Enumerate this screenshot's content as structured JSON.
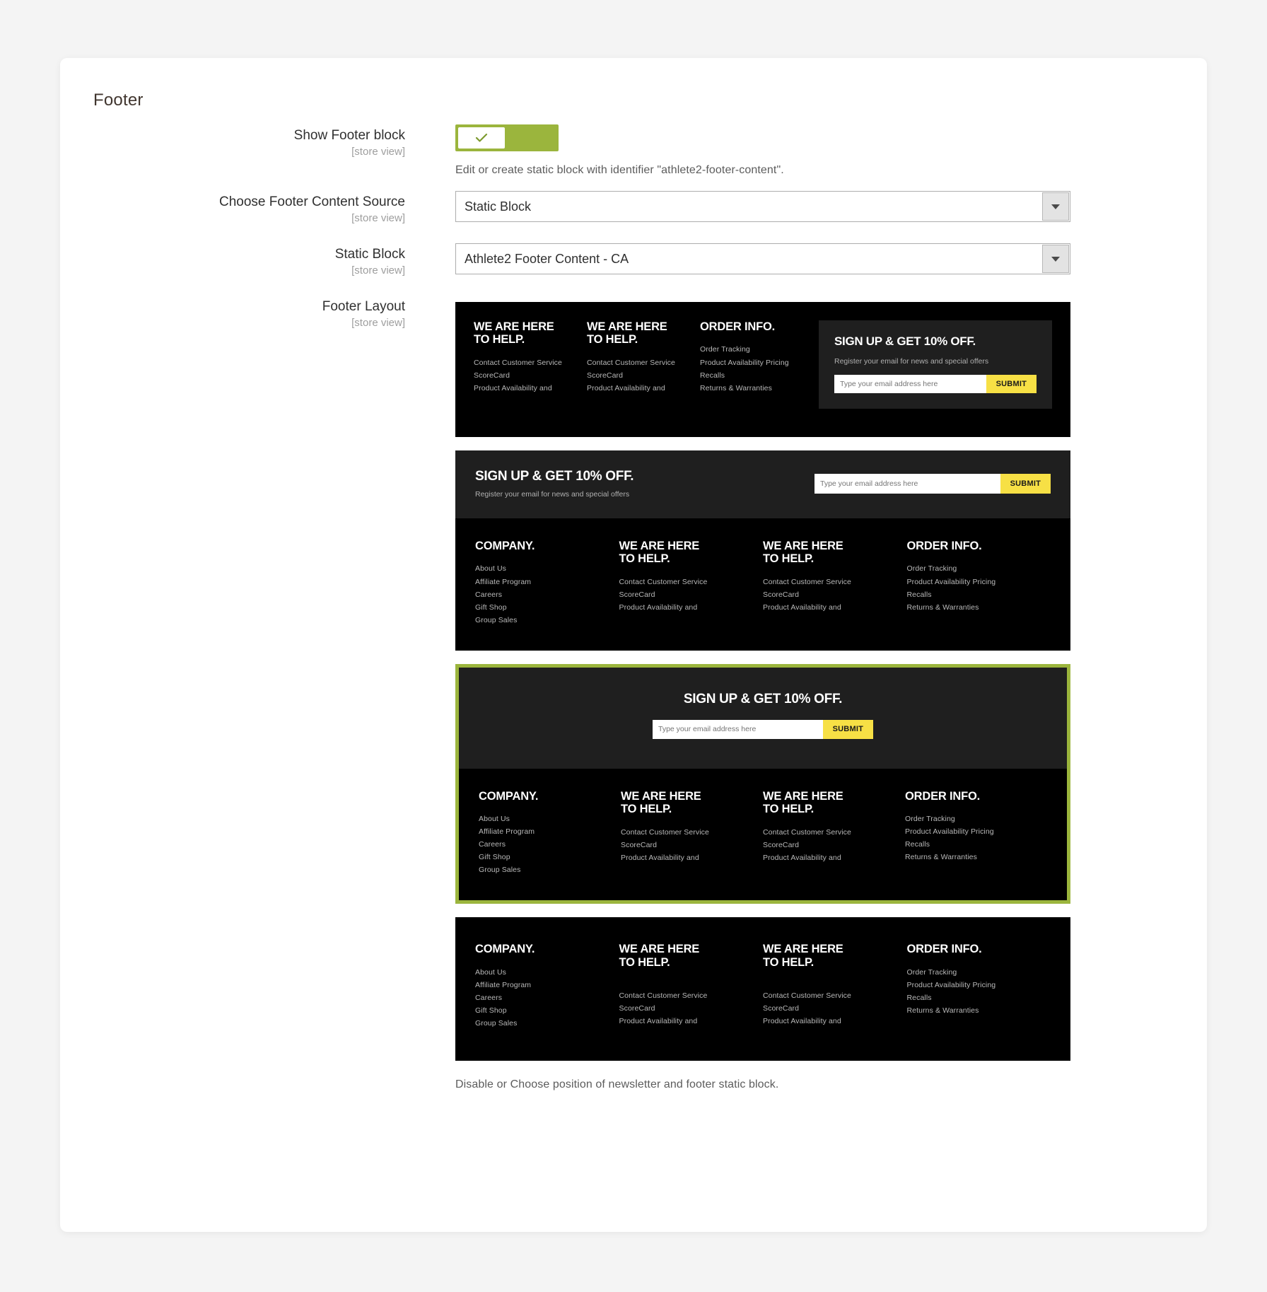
{
  "section": {
    "title": "Footer"
  },
  "fields": {
    "show_footer": {
      "label": "Show Footer block",
      "scope": "[store view]",
      "toggle_state": "on",
      "hint": "Edit or create static block with identifier \"athlete2-footer-content\"."
    },
    "content_source": {
      "label": "Choose Footer Content Source",
      "scope": "[store view]",
      "value": "Static Block"
    },
    "static_block": {
      "label": "Static Block",
      "scope": "[store view]",
      "value": "Athlete2 Footer Content - CA"
    },
    "footer_layout": {
      "label": "Footer Layout",
      "scope": "[store view]",
      "note": "Disable or Choose position of newsletter and footer static block."
    }
  },
  "newsletter": {
    "title": "SIGN UP & GET 10% OFF.",
    "subtitle": "Register your email for news and special offers",
    "placeholder": "Type your email address here",
    "submit_label": "SUBMIT"
  },
  "columns": {
    "company": {
      "heading": "COMPANY.",
      "links": [
        "About Us",
        "Affiliate Program",
        "Careers",
        "Gift Shop",
        "Group Sales"
      ]
    },
    "help": {
      "heading": "WE ARE HERE\nTO HELP.",
      "links": [
        "Contact Customer Service",
        "ScoreCard",
        "Product Availability and"
      ]
    },
    "order": {
      "heading": "ORDER INFO.",
      "links": [
        "Order Tracking",
        "Product Availability Pricing",
        "Recalls",
        "Returns & Warranties"
      ]
    }
  },
  "layouts": [
    {
      "id": "layout-1",
      "selected": false
    },
    {
      "id": "layout-2",
      "selected": false
    },
    {
      "id": "layout-3",
      "selected": true
    },
    {
      "id": "layout-4",
      "selected": false
    }
  ],
  "colors": {
    "accent_green": "#9bb53d",
    "submit_yellow": "#f7e045",
    "footer_black": "#000000",
    "footer_dark": "#1f1f1f",
    "page_bg": "#f4f4f4"
  }
}
